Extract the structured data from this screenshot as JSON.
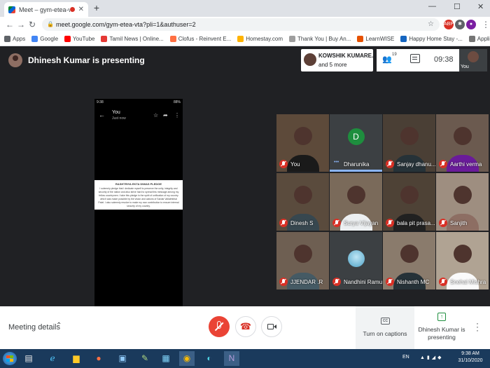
{
  "browser": {
    "tab_title": "Meet – gym-etea-vta",
    "tab_close": "✕",
    "new_tab": "+",
    "url": "meet.google.com/gym-etea-vta?pli=1&authuser=2",
    "window_controls": [
      "—",
      "☐",
      "✕"
    ]
  },
  "bookmarks": [
    {
      "label": "Apps",
      "color": "#5f6368"
    },
    {
      "label": "Google",
      "color": "#4285f4"
    },
    {
      "label": "YouTube",
      "color": "#ff0000"
    },
    {
      "label": "Tamil News | Online...",
      "color": "#e53935"
    },
    {
      "label": "Clofus - Reinvent E...",
      "color": "#ff7043"
    },
    {
      "label": "Homestay.com",
      "color": "#ffb300"
    },
    {
      "label": "Thank You | Buy An...",
      "color": "#9e9e9e"
    },
    {
      "label": "LearnWISE",
      "color": "#e65100"
    },
    {
      "label": "Happy Home Stay -...",
      "color": "#1565c0"
    },
    {
      "label": "Application Form",
      "color": "#757575"
    }
  ],
  "meet": {
    "presenting_title": "Dhinesh Kumar is presenting",
    "speaker_chip": {
      "name": "KOWSHIK KUMARE...",
      "more": "and 5 more"
    },
    "people_count": "19",
    "clock": "09:38",
    "self_label": "You",
    "phone": {
      "status_time": "9:38",
      "status_right": "88%",
      "contact_name": "You",
      "contact_sub": "Just now",
      "doc_title": "RASHTRIYA EKTA DIWAS PLEDGE",
      "doc_body": "I solemnly pledge that I dedicate myself to preserve the unity, integrity and security of the nation and also strive hard to spread this message among my fellow countrymen. I take this pledge in the spirit of unification of my country which was made possible by the vision and actions of Sardar Vallabhbhai Patel. I also solemnly resolve to make my own contribution to ensure internal security of my country."
    },
    "participants": [
      {
        "name": "You",
        "type": "video",
        "body": "#1a1a1a",
        "bg": "#5d4a3a"
      },
      {
        "name": "Dharunika",
        "type": "letter",
        "letter": "D",
        "bg": "#3c4043",
        "speaking": true
      },
      {
        "name": "Sanjay dhanu...",
        "type": "video",
        "body": "#263238",
        "bg": "#4a3f35"
      },
      {
        "name": "Aarthi verma",
        "type": "video",
        "body": "#6a1b9a",
        "bg": "#6b5a4f"
      },
      {
        "name": "Dinesh S",
        "type": "video",
        "body": "#37474f",
        "bg": "#5a4b3d"
      },
      {
        "name": "Surya Vijayan",
        "type": "video",
        "body": "#eceff1",
        "bg": "#7a6a5a"
      },
      {
        "name": "bala pit prasa...",
        "type": "video",
        "body": "#212121",
        "bg": "#4e4236"
      },
      {
        "name": "Sanjith",
        "type": "video",
        "body": "#8d6e63",
        "bg": "#9e8e80"
      },
      {
        "name": "JJENDAR .R",
        "type": "video",
        "body": "#455a64",
        "bg": "#6e5f52"
      },
      {
        "name": "Nandhini Ramu",
        "type": "photo",
        "bg": "#3c4043"
      },
      {
        "name": "Nishanth MC",
        "type": "video",
        "body": "#263238",
        "bg": "#8a7b6c"
      },
      {
        "name": "Snehal Mishra",
        "type": "video",
        "body": "#fafafa",
        "bg": "#b0a393"
      }
    ],
    "meeting_details": "Meeting details",
    "captions_label": "Turn on captions",
    "cc_text": "CC",
    "present_label": "Dhinesh Kumar is presenting"
  },
  "taskbar": {
    "lang": "EN",
    "time": "9:38 AM",
    "date": "31/10/2020"
  },
  "colors": {
    "meet_bg": "#202124",
    "mic_off_red": "#ea4335",
    "speaking_border": "#8ab4f8",
    "present_green": "#1e8e3e"
  }
}
